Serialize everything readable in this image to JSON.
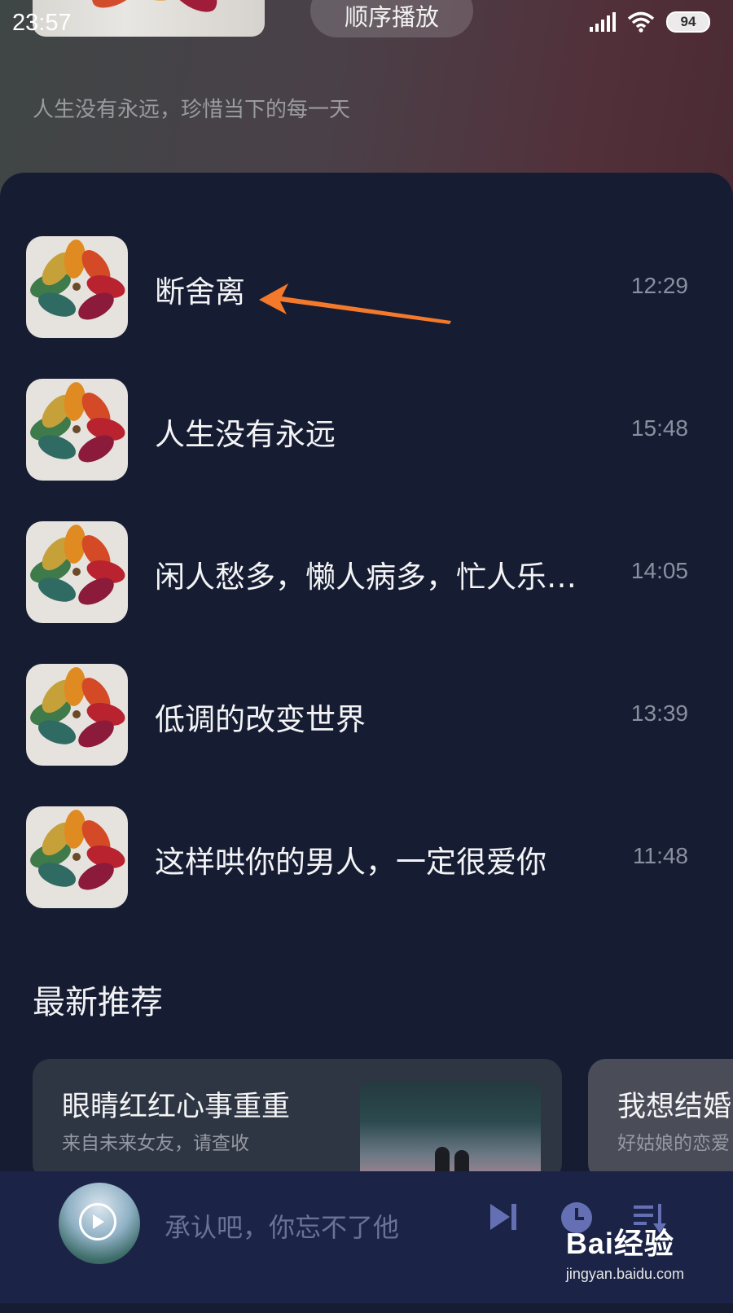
{
  "status_bar": {
    "time": "23:57",
    "battery": "94"
  },
  "header": {
    "play_mode": "顺序播放",
    "tagline": "人生没有永远，珍惜当下的每一天"
  },
  "songs": [
    {
      "title": "断舍离",
      "duration": "12:29"
    },
    {
      "title": "人生没有永远",
      "duration": "15:48"
    },
    {
      "title": "闲人愁多，懒人病多，忙人乐…",
      "duration": "14:05"
    },
    {
      "title": "低调的改变世界",
      "duration": "13:39"
    },
    {
      "title": "这样哄你的男人，一定很爱你",
      "duration": "11:48"
    }
  ],
  "recommend": {
    "section_title": "最新推荐",
    "cards": [
      {
        "title": "眼睛红红心事重重",
        "subtitle": "来自未来女友，请查收"
      },
      {
        "title": "我想结婚",
        "subtitle": "好姑娘的恋爱"
      }
    ]
  },
  "player": {
    "now_playing": "承认吧，你忘不了他"
  },
  "watermark": {
    "logo": "Bai经验",
    "url": "jingyan.baidu.com"
  },
  "colors": {
    "accent_arrow": "#f5792a",
    "panel": "#161d33",
    "player_bar": "#1b2346"
  }
}
